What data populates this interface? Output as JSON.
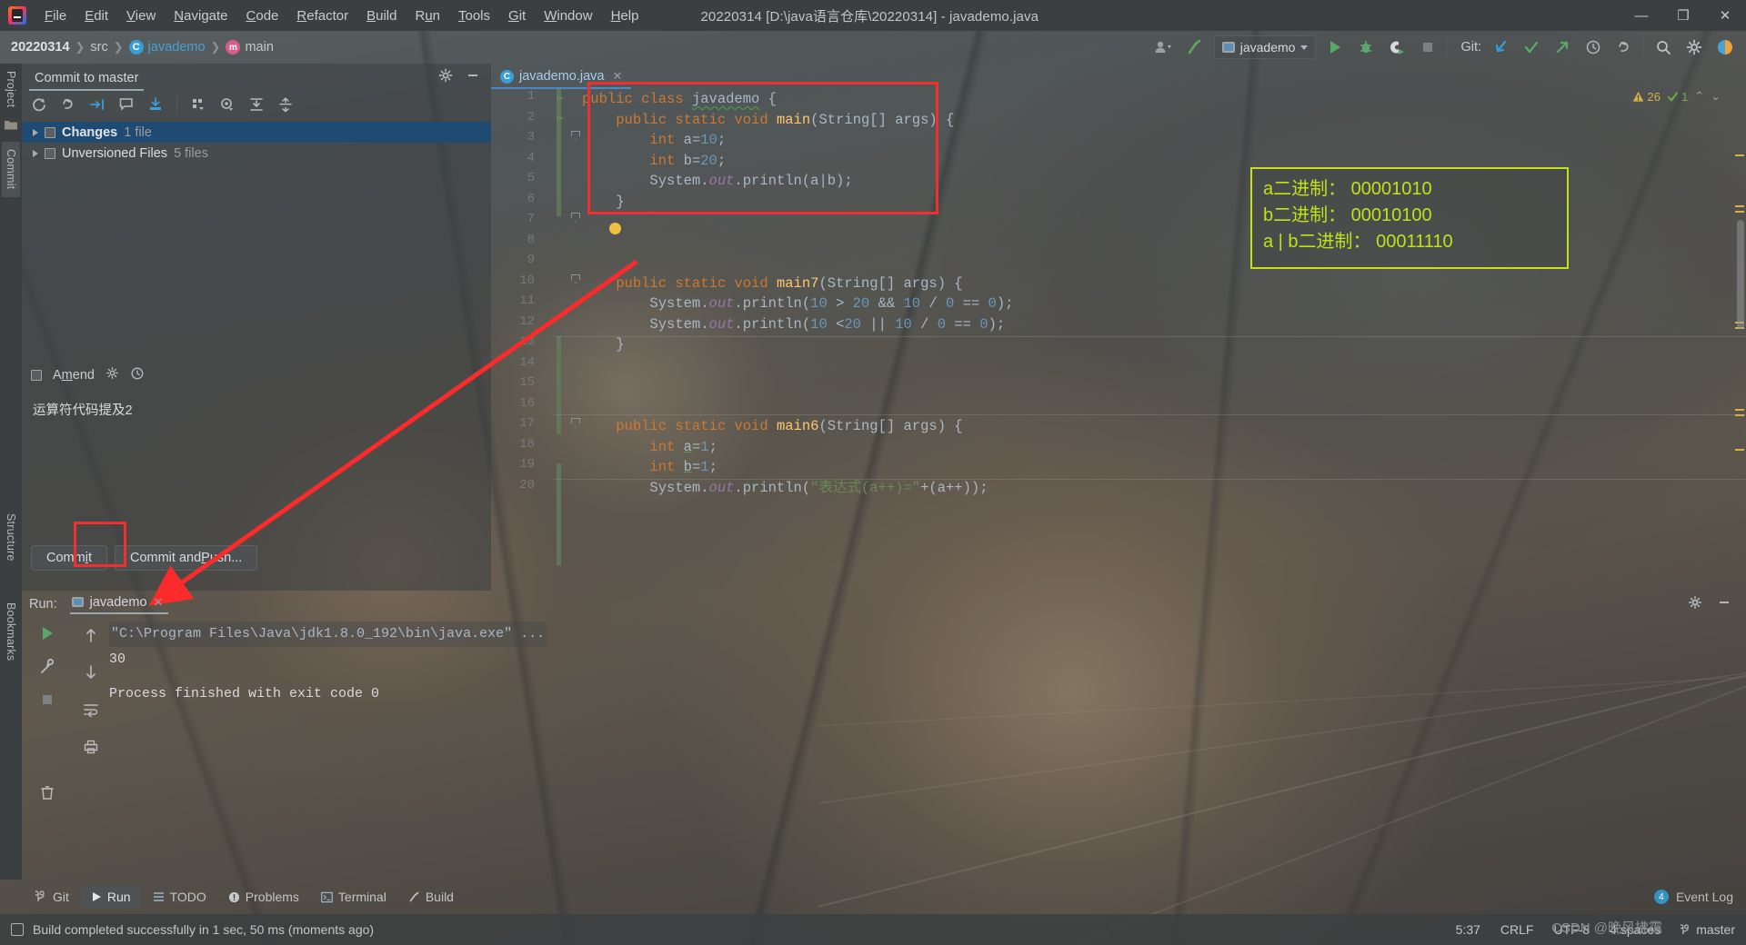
{
  "titlebar": {
    "app_icon": "intellij-logo-icon",
    "window_title": "20220314 [D:\\java语言仓库\\20220314] - javademo.java",
    "menu": [
      {
        "label": "File"
      },
      {
        "label": "Edit"
      },
      {
        "label": "View"
      },
      {
        "label": "Navigate"
      },
      {
        "label": "Code"
      },
      {
        "label": "Refactor"
      },
      {
        "label": "Build"
      },
      {
        "label": "Run"
      },
      {
        "label": "Tools"
      },
      {
        "label": "Git"
      },
      {
        "label": "Window"
      },
      {
        "label": "Help"
      }
    ],
    "minimize": "—",
    "maximize": "❐",
    "close": "✕"
  },
  "navbar": {
    "breadcrumb": [
      "20220314",
      "src",
      "javademo",
      "main"
    ],
    "run_config": "javademo",
    "git_label": "Git:"
  },
  "left_strip": {
    "project": "Project",
    "commit": "Commit",
    "structure": "Structure",
    "bookmarks": "Bookmarks"
  },
  "commit_panel": {
    "tab": "Commit to master",
    "changes": {
      "label": "Changes",
      "count": "1 file"
    },
    "unversioned": {
      "label": "Unversioned Files",
      "count": "5 files"
    },
    "amend_label": "Amend",
    "message": "运算符代码提及2",
    "commit_button": "Commit",
    "commit_push_button": "Commit and Push..."
  },
  "editor": {
    "tab": "javademo.java",
    "warnings": "26",
    "oks": "1",
    "lines": [
      {
        "n": 1,
        "text": "public class javademo {"
      },
      {
        "n": 2,
        "text": "    public static void main(String[] args) {"
      },
      {
        "n": 3,
        "text": "        int a=10;"
      },
      {
        "n": 4,
        "text": "        int b=20;"
      },
      {
        "n": 5,
        "text": "        System.out.println(a|b);"
      },
      {
        "n": 6,
        "text": "    }"
      },
      {
        "n": 7,
        "text": ""
      },
      {
        "n": 8,
        "text": ""
      },
      {
        "n": 9,
        "text": ""
      },
      {
        "n": 10,
        "text": "    public static void main7(String[] args) {"
      },
      {
        "n": 11,
        "text": "        System.out.println(10 > 20 && 10 / 0 == 0);"
      },
      {
        "n": 12,
        "text": "        System.out.println(10 <20 || 10 / 0 == 0);"
      },
      {
        "n": 13,
        "text": "    }"
      },
      {
        "n": 14,
        "text": ""
      },
      {
        "n": 15,
        "text": ""
      },
      {
        "n": 16,
        "text": ""
      },
      {
        "n": 17,
        "text": "    public static void main6(String[] args) {"
      },
      {
        "n": 18,
        "text": "        int a=1;"
      },
      {
        "n": 19,
        "text": "        int b=1;"
      },
      {
        "n": 20,
        "text": "        System.out.println(\"表达式(a++)=\"+(a++));"
      }
    ]
  },
  "annotation": {
    "line1": "a二进制：  00001010",
    "line2": "b二进制：  00010100",
    "line3": "a | b二进制：  00011110",
    "border_color": "#c8e018",
    "text_color": "#c2e01a"
  },
  "run_panel": {
    "label": "Run:",
    "tab": "javademo",
    "command": "\"C:\\Program Files\\Java\\jdk1.8.0_192\\bin\\java.exe\" ...",
    "output": "30",
    "finished": "Process finished with exit code 0"
  },
  "bottom_tabs": [
    {
      "label": "Git",
      "icon": "branch-icon",
      "selected": false
    },
    {
      "label": "Run",
      "icon": "play-icon",
      "selected": true
    },
    {
      "label": "TODO",
      "icon": "list-icon",
      "selected": false
    },
    {
      "label": "Problems",
      "icon": "warning-icon",
      "selected": false
    },
    {
      "label": "Terminal",
      "icon": "terminal-icon",
      "selected": false
    },
    {
      "label": "Build",
      "icon": "hammer-icon",
      "selected": false
    }
  ],
  "event_log": {
    "count": "4",
    "label": "Event Log"
  },
  "statusbar": {
    "message": "Build completed successfully in 1 sec, 50 ms (moments ago)",
    "caret": "5:37",
    "line_sep": "CRLF",
    "encoding": "UTF-8",
    "indent": "4 spaces",
    "branch": "master"
  },
  "watermark": "CSDN @晚风拂霭"
}
